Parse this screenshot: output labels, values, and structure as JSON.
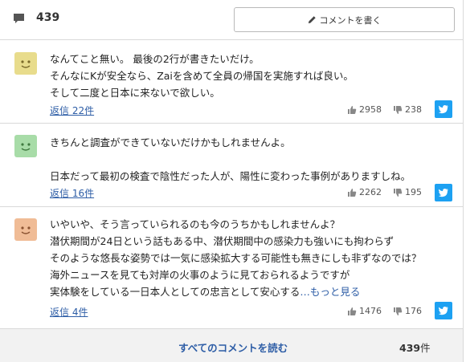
{
  "header": {
    "comment_count": "439",
    "write_button_label": "コメントを書く"
  },
  "comments": [
    {
      "avatar_color": "#e8dc8c",
      "lines": "なんてこと無い。 最後の2行が書きたいだけ。\nそんなにKが安全なら、Zaiを含めて全員の帰国を実施すれば良い。\nそして二度と日本に来ないで欲しい。",
      "reply_label": "返信 22件",
      "likes": "2958",
      "dislikes": "238"
    },
    {
      "avatar_color": "#a8dca8",
      "lines": "きちんと調査ができていないだけかもしれませんよ。\n\n日本だって最初の検査で陰性だった人が、陽性に変わった事例がありますしね。",
      "reply_label": "返信 16件",
      "likes": "2262",
      "dislikes": "195"
    },
    {
      "avatar_color": "#f0bc96",
      "lines": "いやいや、そう言っていられるのも今のうちかもしれませんよ？\n潜伏期間が24日という話もある中、潜伏期間中の感染力も強いにも拘わらず\nそのような悠長な姿勢では一気に感染拡大する可能性も無きにしも非ずなのでは？\n海外ニュースを見ても対岸の火事のように見ておられるようですが\n実体験をしている一日本人としての忠言として安心する",
      "ellipsis": "…",
      "more_label": "もっと見る",
      "reply_label": "返信 4件",
      "likes": "1476",
      "dislikes": "176"
    }
  ],
  "footer": {
    "all_comments_label": "すべてのコメントを読む",
    "total_number": "439",
    "total_unit": "件"
  },
  "colors": {
    "link": "#2d5da6",
    "twitter": "#1da1f2",
    "border": "#d9d9d9"
  }
}
